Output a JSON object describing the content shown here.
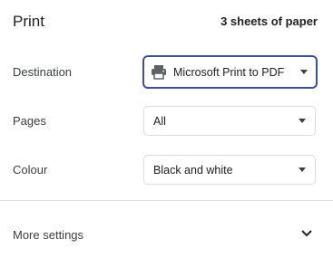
{
  "header": {
    "title": "Print",
    "sheets": "3 sheets of paper"
  },
  "destination": {
    "label": "Destination",
    "value": "Microsoft Print to PDF",
    "icon": "printer-icon"
  },
  "pages": {
    "label": "Pages",
    "value": "All"
  },
  "colour": {
    "label": "Colour",
    "value": "Black and white"
  },
  "more_settings": {
    "label": "More settings",
    "icon": "chevron-down-icon"
  },
  "colors": {
    "focus_border": "#3c4fa0",
    "text": "#202124",
    "border": "#dadce0"
  }
}
